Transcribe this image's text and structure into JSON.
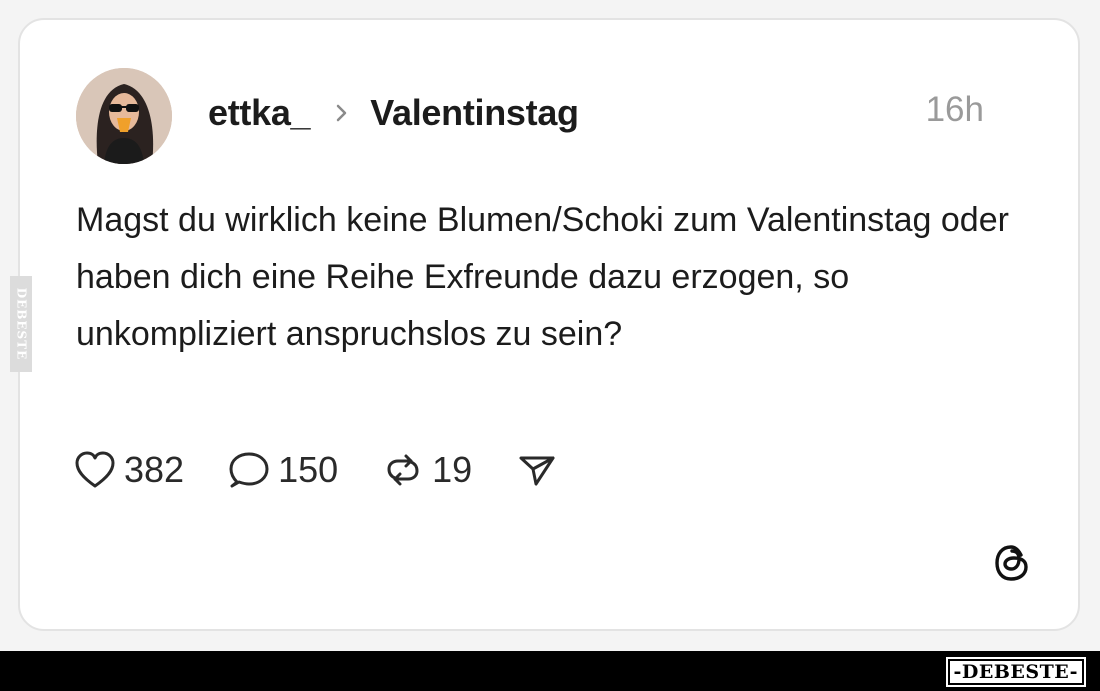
{
  "post": {
    "username": "ettka_",
    "topic": "Valentinstag",
    "timestamp": "16h",
    "text": "Magst du wirklich keine Blumen/Schoki zum Valentinstag oder haben dich eine Reihe Exfreunde dazu erzogen, so unkompliziert anspruchslos zu sein?",
    "actions": {
      "likes": "382",
      "replies": "150",
      "reposts": "19"
    }
  },
  "icons": {
    "like": "heart-icon",
    "reply": "speech-bubble-icon",
    "repost": "repost-arrows-icon",
    "share": "send-paper-plane-icon",
    "brand": "threads-logo-icon",
    "separator": "chevron-right-icon"
  },
  "watermark": {
    "side": "DEBESTE",
    "bottom": "-DEBESTE-"
  },
  "colors": {
    "text": "#1c1c1c",
    "muted": "#9a9a9a",
    "card_bg": "#ffffff",
    "card_border": "#e3e3e3",
    "bottom_bar": "#000000"
  }
}
